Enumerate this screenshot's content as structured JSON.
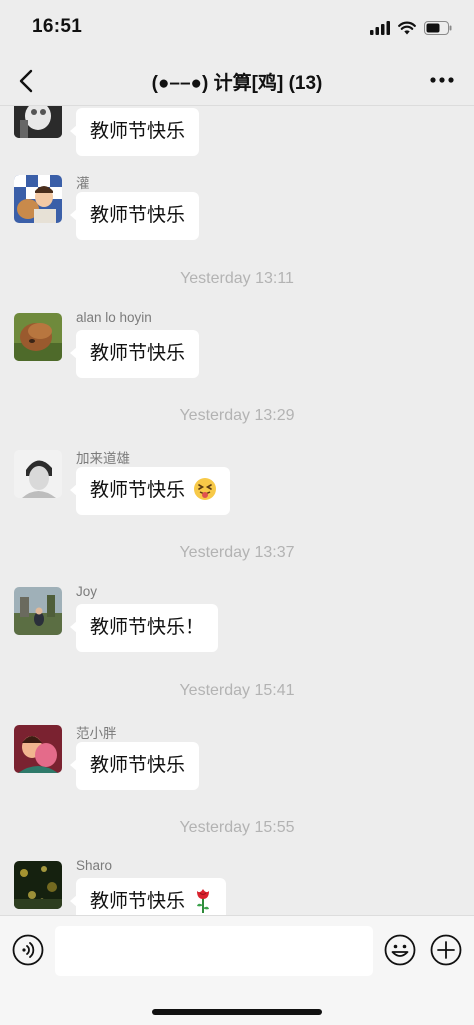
{
  "status_bar": {
    "time": "16:51"
  },
  "header": {
    "title": "(●––●) 计算[鸡] (13)"
  },
  "messages": [
    {
      "sender": "",
      "text": "教师节快乐",
      "avatar": "cat-photo"
    },
    {
      "sender": "灌",
      "text": "教师节快乐",
      "avatar": "cartoon-dog-boy"
    },
    {
      "timestamp": "Yesterday 13:11"
    },
    {
      "sender": "alan lo hoyin",
      "text": "教师节快乐",
      "avatar": "highland-cow"
    },
    {
      "timestamp": "Yesterday 13:29"
    },
    {
      "sender": "加来道雄",
      "text": "教师节快乐",
      "emoji": "squinting-tongue-face",
      "avatar": "bw-portrait"
    },
    {
      "timestamp": "Yesterday 13:37"
    },
    {
      "sender": "Joy",
      "text": "教师节快乐！",
      "avatar": "landscape-photo"
    },
    {
      "timestamp": "Yesterday 15:41"
    },
    {
      "sender": "范小胖",
      "text": "教师节快乐",
      "avatar": "cartoon-characters"
    },
    {
      "timestamp": "Yesterday 15:55"
    },
    {
      "sender": "Sharo",
      "text": "教师节快乐",
      "emoji": "rose",
      "avatar": "dark-bokeh"
    }
  ],
  "input_bar": {
    "placeholder": ""
  },
  "colors": {
    "background": "#ededed",
    "bubble": "#ffffff",
    "timestamp": "#b3b3b3",
    "sender": "#7b7b7b"
  }
}
